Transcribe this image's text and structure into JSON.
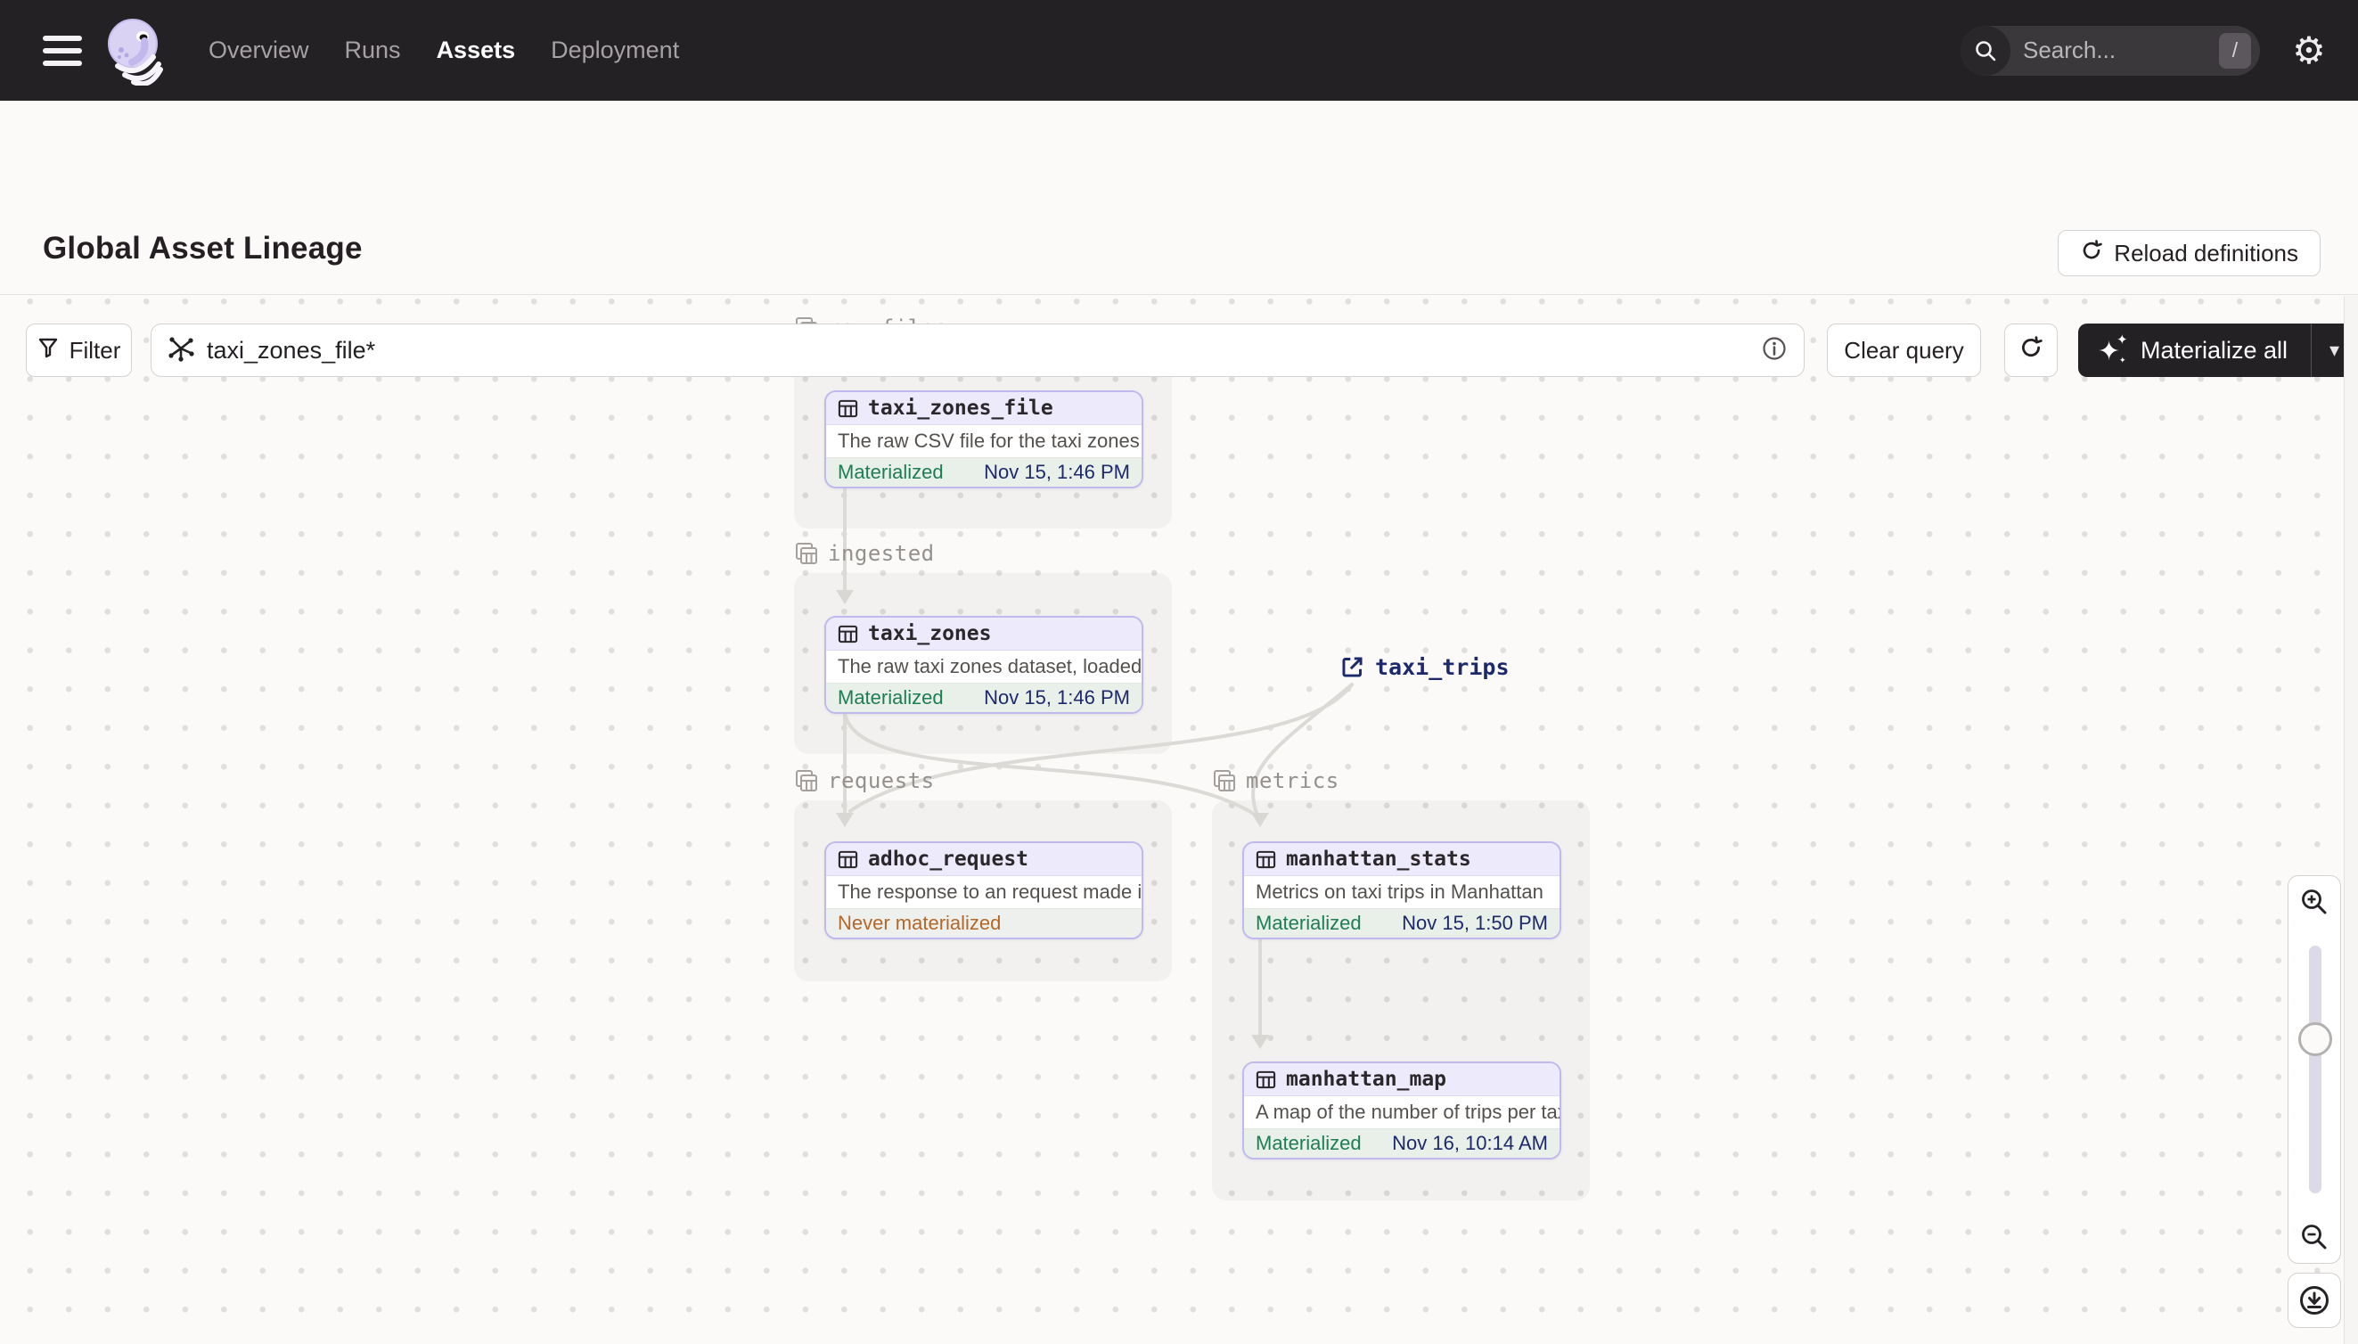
{
  "colors": {
    "navbar_bg": "#242124",
    "accent_purple_border": "#bfb9ee",
    "node_header_bg": "#eceafb",
    "status_green": "#1e7e53",
    "timestamp_navy": "#1c2a6b",
    "warning_orange": "#b3682a",
    "edge_gray": "#dcdad7",
    "canvas_bg": "#fbfaf9"
  },
  "navbar": {
    "items": [
      {
        "label": "Overview",
        "active": false
      },
      {
        "label": "Runs",
        "active": false
      },
      {
        "label": "Assets",
        "active": true
      },
      {
        "label": "Deployment",
        "active": false
      }
    ],
    "search_placeholder": "Search...",
    "search_shortcut": "/"
  },
  "header": {
    "title": "Global Asset Lineage",
    "reload_button_label": "Reload definitions"
  },
  "toolbar": {
    "filter_label": "Filter",
    "query_value": "taxi_zones_file*",
    "clear_query_label": "Clear query",
    "materialize_label": "Materialize all"
  },
  "graph": {
    "groups": [
      {
        "label": "raw_files"
      },
      {
        "label": "ingested"
      },
      {
        "label": "requests"
      },
      {
        "label": "metrics"
      }
    ],
    "nodes": [
      {
        "name": "taxi_zones_file",
        "description": "The raw CSV file for the taxi zones dat...",
        "status": "Materialized",
        "timestamp": "Nov 15, 1:46 PM"
      },
      {
        "name": "taxi_zones",
        "description": "The raw taxi zones dataset, loaded int...",
        "status": "Materialized",
        "timestamp": "Nov 15, 1:46 PM"
      },
      {
        "name": "adhoc_request",
        "description": "The response to an request made in th...",
        "status": "Never materialized",
        "timestamp": ""
      },
      {
        "name": "manhattan_stats",
        "description": "Metrics on taxi trips in Manhattan",
        "status": "Materialized",
        "timestamp": "Nov 15, 1:50 PM"
      },
      {
        "name": "manhattan_map",
        "description": "A map of the number of trips per taxi z...",
        "status": "Materialized",
        "timestamp": "Nov 16, 10:14 AM"
      }
    ],
    "external_node": {
      "name": "taxi_trips"
    },
    "edges": [
      "taxi_zones_file -> taxi_zones",
      "taxi_zones -> adhoc_request",
      "taxi_zones -> manhattan_stats",
      "taxi_trips -> adhoc_request",
      "taxi_trips -> manhattan_stats",
      "manhattan_stats -> manhattan_map"
    ]
  }
}
